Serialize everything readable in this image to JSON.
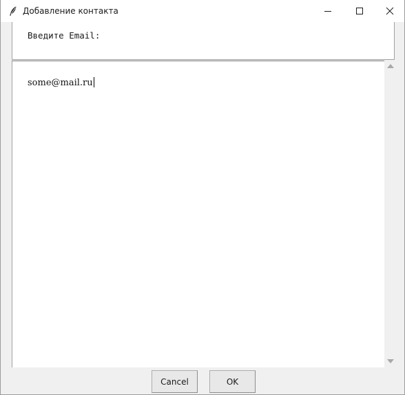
{
  "window": {
    "title": "Добавление контакта"
  },
  "title_bar_buttons": {
    "minimize_icon": "minimize-icon",
    "maximize_icon": "maximize-icon",
    "close_icon": "close-icon"
  },
  "dialog": {
    "prompt": "Введите Email:",
    "input_value": "some@mail.ru"
  },
  "buttons": {
    "cancel_label": "Cancel",
    "ok_label": "OK"
  },
  "colors": {
    "window_background": "#f0f0f0",
    "field_background": "#ffffff",
    "scroll_arrow": "#a8a8a8"
  }
}
